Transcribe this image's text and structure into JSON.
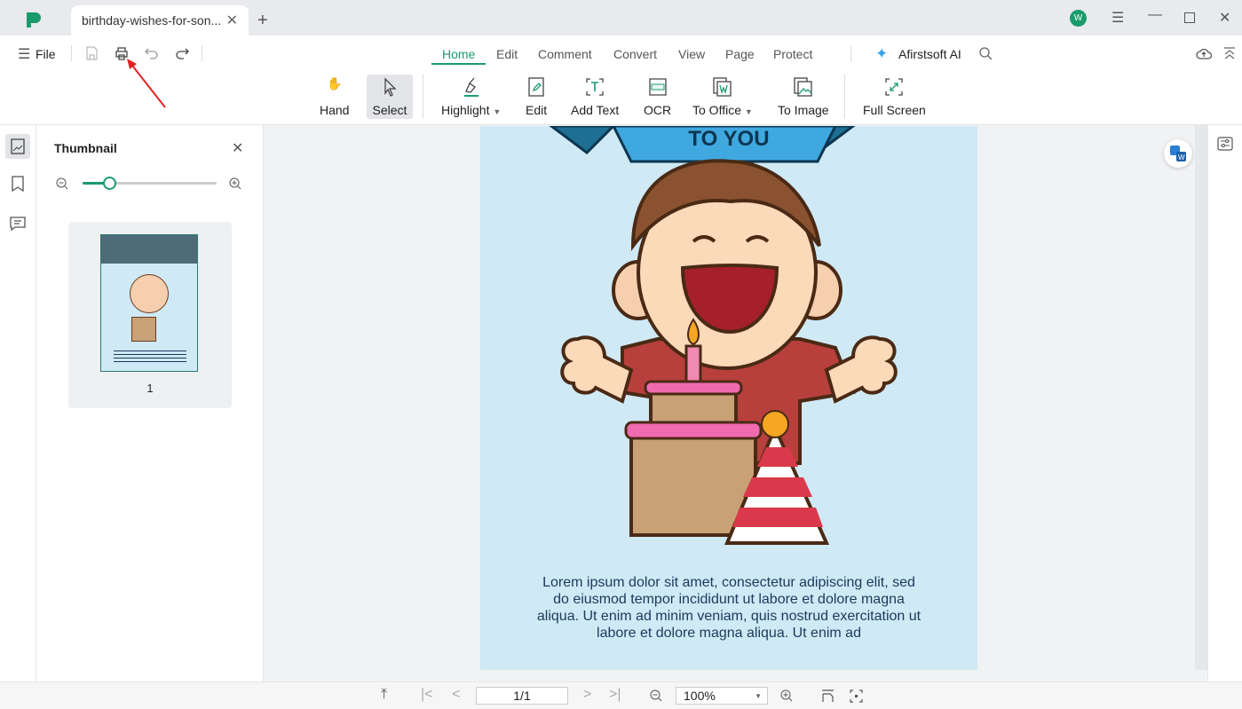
{
  "window": {
    "tab_title": "birthday-wishes-for-son...",
    "avatar_letter": "W",
    "brand_color": "#1a9b6c"
  },
  "quickbar": {
    "file_label": "File"
  },
  "menu_tabs": [
    {
      "label": "Home",
      "active": true
    },
    {
      "label": "Edit"
    },
    {
      "label": "Comment"
    },
    {
      "label": "Convert"
    },
    {
      "label": "View"
    },
    {
      "label": "Page"
    },
    {
      "label": "Protect"
    }
  ],
  "ai_label": "Afirstsoft AI",
  "tools": [
    {
      "label": "Hand"
    },
    {
      "label": "Select",
      "selected": true
    },
    {
      "label": "Highlight"
    },
    {
      "label": "Edit"
    },
    {
      "label": "Add Text"
    },
    {
      "label": "OCR"
    },
    {
      "label": "To Office"
    },
    {
      "label": "To Image"
    },
    {
      "label": "Full Screen"
    }
  ],
  "thumbnail": {
    "title": "Thumbnail",
    "zoom_fraction": 0.2,
    "pages": [
      {
        "number": "1"
      }
    ]
  },
  "document": {
    "banner_text": "TO YOU",
    "body_text": "Lorem ipsum dolor sit amet, consectetur adipiscing elit, sed do eiusmod tempor incididunt ut labore et dolore magna aliqua. Ut enim ad minim veniam, quis nostrud exercitation ut labore et dolore magna aliqua. Ut enim ad"
  },
  "footer": {
    "page_indicator": "1/1",
    "zoom_value": "100%"
  }
}
